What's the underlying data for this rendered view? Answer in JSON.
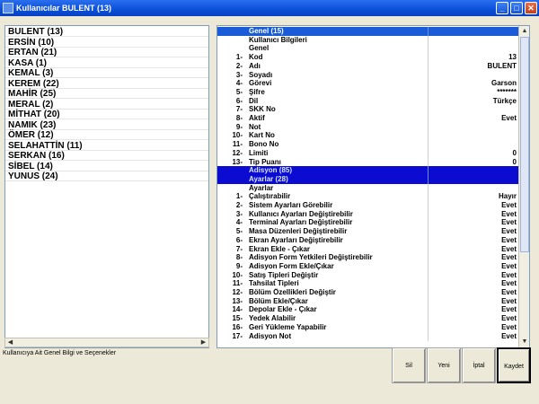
{
  "window": {
    "title": "Kullanıcılar BULENT  (13)"
  },
  "users": [
    "BULENT  (13)",
    "ERSİN  (10)",
    "ERTAN  (21)",
    "KASA  (1)",
    "KEMAL  (3)",
    "KEREM  (22)",
    "MAHİR  (25)",
    "MERAL  (2)",
    "MİTHAT  (20)",
    "NAMIK  (23)",
    "ÖMER  (12)",
    "SELAHATTİN  (11)",
    "SERKAN  (16)",
    "SİBEL  (14)",
    "YUNUS  (24)"
  ],
  "properties": [
    {
      "num": "",
      "label": "Genel (15)",
      "value": "",
      "kind": "sel"
    },
    {
      "num": "",
      "label": "Kullanıcı Bilgileri",
      "value": "",
      "kind": ""
    },
    {
      "num": "",
      "label": "Genel",
      "value": "",
      "kind": ""
    },
    {
      "num": "1-",
      "label": "Kod",
      "value": "13",
      "kind": ""
    },
    {
      "num": "2-",
      "label": "Adı",
      "value": "BULENT",
      "kind": ""
    },
    {
      "num": "3-",
      "label": "Soyadı",
      "value": "",
      "kind": ""
    },
    {
      "num": "4-",
      "label": "Görevi",
      "value": "Garson",
      "kind": ""
    },
    {
      "num": "5-",
      "label": "Şifre",
      "value": "*******",
      "kind": ""
    },
    {
      "num": "6-",
      "label": "Dil",
      "value": "Türkçe",
      "kind": ""
    },
    {
      "num": "7-",
      "label": "SKK No",
      "value": "",
      "kind": ""
    },
    {
      "num": "8-",
      "label": "Aktif",
      "value": "Evet",
      "kind": ""
    },
    {
      "num": "9-",
      "label": "Not",
      "value": "",
      "kind": ""
    },
    {
      "num": "10-",
      "label": "Kart No",
      "value": "",
      "kind": ""
    },
    {
      "num": "11-",
      "label": "Bono No",
      "value": "",
      "kind": ""
    },
    {
      "num": "12-",
      "label": "Limiti",
      "value": "0",
      "kind": ""
    },
    {
      "num": "13-",
      "label": "Tip Puanı",
      "value": "0",
      "kind": ""
    },
    {
      "num": "",
      "label": "Adisyon (85)",
      "value": "",
      "kind": "grp"
    },
    {
      "num": "",
      "label": "Ayarlar (28)",
      "value": "",
      "kind": "grp"
    },
    {
      "num": "",
      "label": "Ayarlar",
      "value": "",
      "kind": ""
    },
    {
      "num": "1-",
      "label": "Çalıştırabilir",
      "value": "Hayır",
      "kind": ""
    },
    {
      "num": "2-",
      "label": "Sistem Ayarları Görebilir",
      "value": "Evet",
      "kind": ""
    },
    {
      "num": "3-",
      "label": "Kullanıcı Ayarları Değiştirebilir",
      "value": "Evet",
      "kind": ""
    },
    {
      "num": "4-",
      "label": "Terminal Ayarları Değiştirebilir",
      "value": "Evet",
      "kind": ""
    },
    {
      "num": "5-",
      "label": "Masa Düzenleri Değiştirebilir",
      "value": "Evet",
      "kind": ""
    },
    {
      "num": "6-",
      "label": "Ekran Ayarları Değiştirebilir",
      "value": "Evet",
      "kind": ""
    },
    {
      "num": "7-",
      "label": "Ekran Ekle - Çıkar",
      "value": "Evet",
      "kind": ""
    },
    {
      "num": "8-",
      "label": "Adisyon Form Yetkileri Değiştirebilir",
      "value": "Evet",
      "kind": ""
    },
    {
      "num": "9-",
      "label": "Adisyon Form Ekle/Çıkar",
      "value": "Evet",
      "kind": ""
    },
    {
      "num": "10-",
      "label": "Satış Tipleri Değiştir",
      "value": "Evet",
      "kind": ""
    },
    {
      "num": "11-",
      "label": "Tahsilat Tipleri",
      "value": "Evet",
      "kind": ""
    },
    {
      "num": "12-",
      "label": "Bölüm Özellikleri Değiştir",
      "value": "Evet",
      "kind": ""
    },
    {
      "num": "13-",
      "label": "Bölüm Ekle/Çıkar",
      "value": "Evet",
      "kind": ""
    },
    {
      "num": "14-",
      "label": "Depolar Ekle - Çıkar",
      "value": "Evet",
      "kind": ""
    },
    {
      "num": "15-",
      "label": "Yedek Alabilir",
      "value": "Evet",
      "kind": ""
    },
    {
      "num": "16-",
      "label": "Geri Yükleme Yapabilir",
      "value": "Evet",
      "kind": ""
    },
    {
      "num": "17-",
      "label": "Adisyon Not",
      "value": "Evet",
      "kind": ""
    }
  ],
  "status": {
    "text": "Kullanıcıya Ait Genel Bilgi ve Seçenekler"
  },
  "buttons": {
    "delete": "Sil",
    "new": "Yeni",
    "cancel": "İptal",
    "save": "Kaydet"
  },
  "icons": {
    "minimize": "minimize-icon",
    "maximize": "maximize-icon",
    "close": "close-icon"
  },
  "colors": {
    "titlebar": "#0a4fd8",
    "selected_row": "#1a5bd8",
    "group_row": "#0b0bd2"
  }
}
